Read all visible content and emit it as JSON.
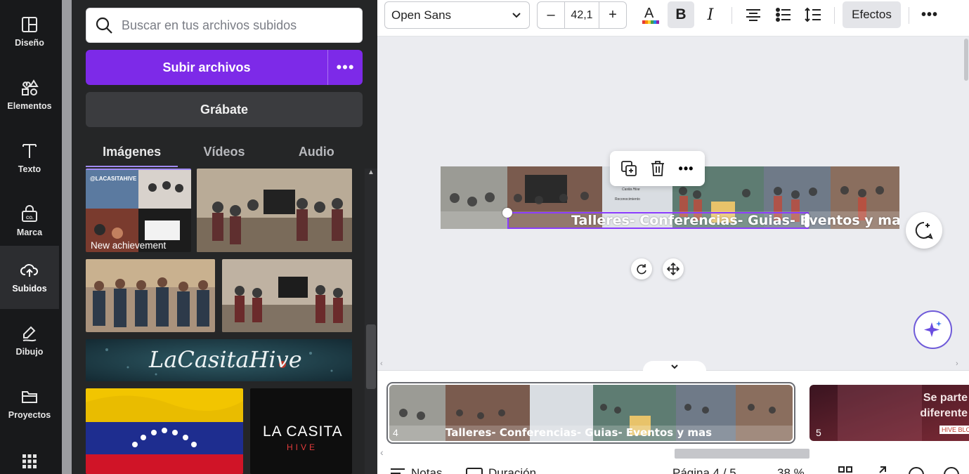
{
  "rail": {
    "items": [
      {
        "label": "Diseño",
        "icon": "layout-icon"
      },
      {
        "label": "Elementos",
        "icon": "shapes-icon"
      },
      {
        "label": "Texto",
        "icon": "text-icon"
      },
      {
        "label": "Marca",
        "icon": "brand-icon"
      },
      {
        "label": "Subidos",
        "icon": "cloud-upload-icon"
      },
      {
        "label": "Dibujo",
        "icon": "draw-icon"
      },
      {
        "label": "Proyectos",
        "icon": "folder-icon"
      },
      {
        "label": "",
        "icon": "apps-grid-icon"
      }
    ],
    "active_index": 4
  },
  "panel": {
    "search_placeholder": "Buscar en tus archivos subidos",
    "upload_label": "Subir archivos",
    "upload_more": "•••",
    "record_label": "Grábate",
    "tabs": [
      "Imágenes",
      "Vídeos",
      "Audio"
    ],
    "active_tab": 0,
    "gallery": {
      "first_thumb_tag": "@LACASITAHIVE",
      "first_thumb_overlay": "New achievement",
      "banner_text": "LaCasitaHive",
      "logo_text_main": "LA CASITA",
      "logo_text_sub": "HIVE"
    }
  },
  "toolbar": {
    "font_name": "Open Sans",
    "size_minus": "–",
    "font_size": "42,1",
    "size_plus": "+",
    "effects_label": "Efectos",
    "bold_active": true
  },
  "canvas": {
    "text": "Talleres- Conferencias- Guias- Eventos y mas",
    "certificate_title": "Reconocimiento",
    "certificate_name": "Casita Hive"
  },
  "filmstrip": {
    "page4_number": "4",
    "page4_text": "Talleres- Conferencias- Guias- Eventos y mas",
    "page5_number": "5",
    "page5_text_line1": "Se parte",
    "page5_text_line2": "diferente",
    "page5_badge": "HIVE BLOG"
  },
  "footer": {
    "notes_label": "Notas",
    "duration_label": "Duración",
    "page_indicator": "Página 4 / 5",
    "zoom": "38 %"
  },
  "colors": {
    "rail_bg": "#18191b",
    "panel_bg": "#252627",
    "accent_purple": "#7d2ae8",
    "selection": "#8b3dff",
    "canvas_bg": "#ebecf0"
  }
}
